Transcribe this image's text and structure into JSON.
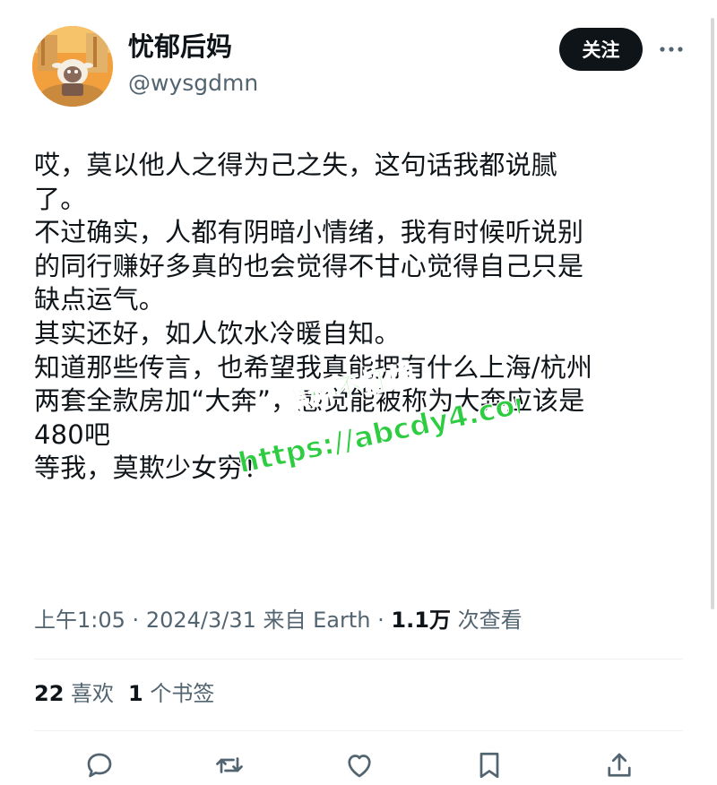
{
  "user": {
    "display_name": "忧郁后妈",
    "handle": "@wysgdmn",
    "follow_label": "关注"
  },
  "tweet": {
    "lines": [
      "哎，莫以他人之得为己之失，这句话我都说腻",
      "了。",
      "不过确实，人都有阴暗小情绪，我有时候听说别",
      "的同行赚好多真的也会觉得不甘心觉得自己只是",
      "缺点运气。",
      "其实还好，如人饮水冷暖自知。",
      "知道那些传言，也希望我真能拥有什么上海/杭州",
      "两套全款房加“大奔”，感觉能被称为大奔应该是",
      "480吧",
      "等我，莫欺少女穷！"
    ]
  },
  "watermark": {
    "line1": "黑料不打烊",
    "line2": "https://abcdy4.com",
    "color": "#2ecc40"
  },
  "meta": {
    "time": "上午1:05",
    "date": "2024/3/31",
    "source": "来自 Earth",
    "views_count": "1.1万",
    "views_label": "次查看"
  },
  "stats": {
    "likes_count": "22",
    "likes_label": "喜欢",
    "bookmarks_count": "1",
    "bookmarks_label": "个书签"
  },
  "icons": [
    "reply-icon",
    "retweet-icon",
    "like-icon",
    "bookmark-icon",
    "share-icon",
    "more-icon"
  ],
  "colors": {
    "primary_text": "#0f1419",
    "secondary_text": "#536471",
    "follow_bg": "#0f1419"
  }
}
